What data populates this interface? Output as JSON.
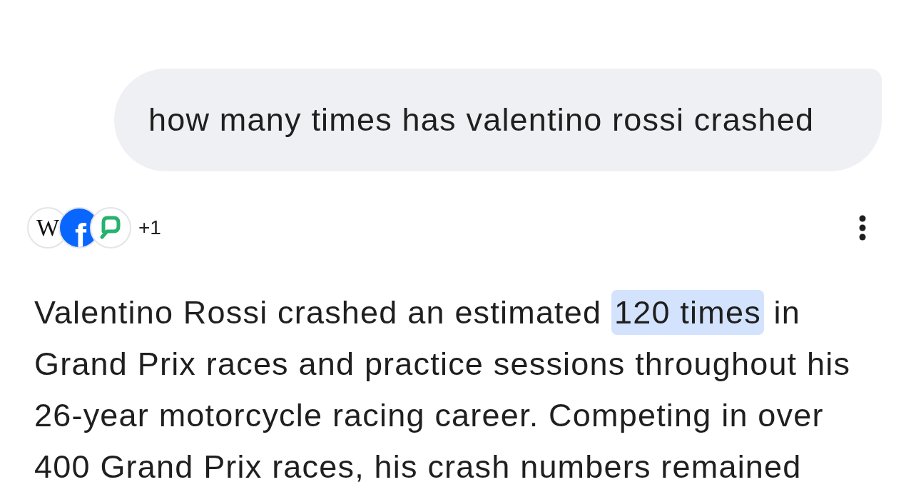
{
  "query": {
    "text": "how many times has valentino rossi crashed"
  },
  "sources": {
    "icons": [
      {
        "kind": "letter_serif",
        "glyph": "W"
      },
      {
        "kind": "letter_disc",
        "glyph": "f"
      },
      {
        "kind": "chat_bubble"
      }
    ],
    "more_count": "+1"
  },
  "answer": {
    "segments": [
      {
        "text": "Valentino Rossi crashed an estimated ",
        "highlighted": false
      },
      {
        "text": "120 times",
        "highlighted": true
      },
      {
        "text": " in Grand Prix races and practice sessions throughout his 26-year motorcycle racing career. Competing in over 400 Grand Prix races, his crash numbers remained",
        "highlighted": false
      }
    ]
  }
}
